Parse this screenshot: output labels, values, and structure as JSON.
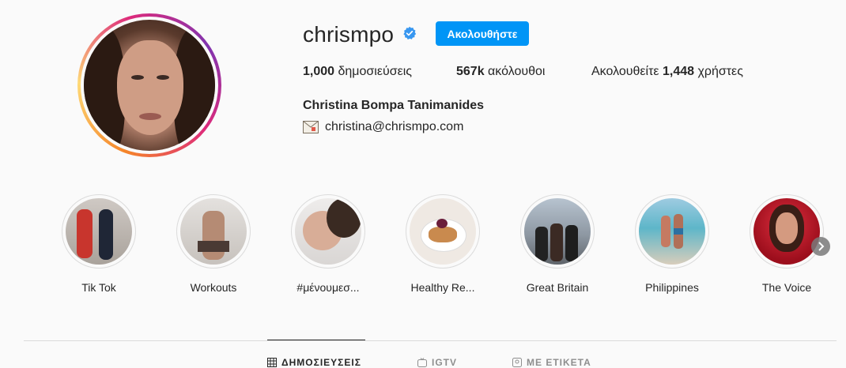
{
  "profile": {
    "username": "chrismpo",
    "verified": true,
    "follow_label": "Ακολουθήστε",
    "posts_count": "1,000",
    "posts_label": " δημοσιεύσεις",
    "followers_count": "567k",
    "followers_label": " ακόλουθοι",
    "following_prefix": "Ακολουθείτε ",
    "following_count": "1,448",
    "following_suffix": " χρήστες",
    "full_name": "Christina Bompa Tanimanides",
    "email": "christina@chrismpo.com",
    "email_icon": "envelope-icon"
  },
  "highlights": [
    {
      "label": "Tik Tok"
    },
    {
      "label": "Workouts"
    },
    {
      "label": "#μένουμεσ..."
    },
    {
      "label": "Healthy Re..."
    },
    {
      "label": "Great Britain"
    },
    {
      "label": "Philippines"
    },
    {
      "label": "The Voice"
    }
  ],
  "tabs": [
    {
      "label": "ΔΗΜΟΣΙΕΥΣΕΙΣ",
      "icon": "grid-icon",
      "active": true
    },
    {
      "label": "IGTV",
      "icon": "igtv-icon",
      "active": false
    },
    {
      "label": "ΜΕ ΕΤΙΚΕΤΑ",
      "icon": "tagged-icon",
      "active": false
    }
  ],
  "colors": {
    "accent": "#0095f6",
    "verified": "#3897f0",
    "text": "#262626",
    "muted": "#8e8e8e",
    "background": "#fafafa"
  }
}
